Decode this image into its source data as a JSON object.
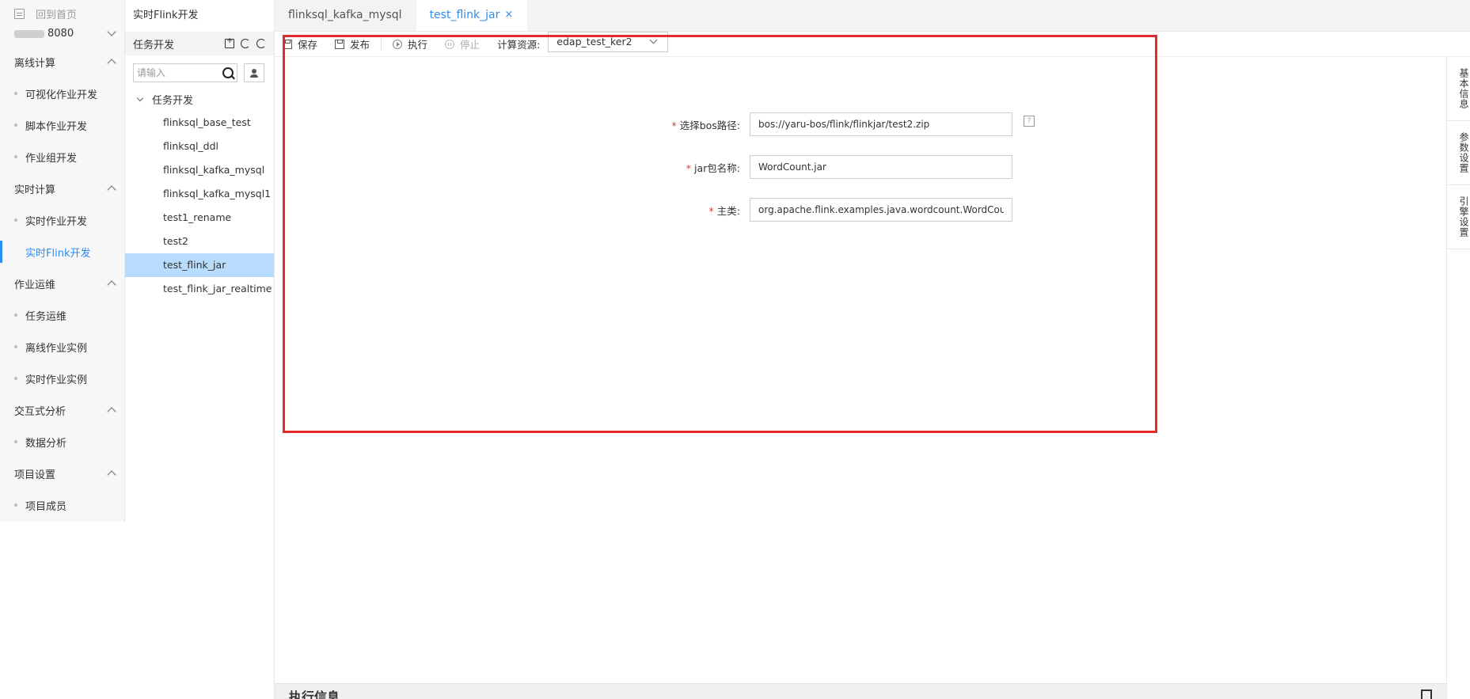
{
  "nav": {
    "home_label": "回到首页",
    "project_label": "8080",
    "groups": [
      {
        "title": "离线计算",
        "items": [
          "可视化作业开发",
          "脚本作业开发",
          "作业组开发"
        ]
      },
      {
        "title": "实时计算",
        "items": [
          "实时作业开发",
          "实时Flink开发"
        ]
      },
      {
        "title": "作业运维",
        "items": [
          "任务运维",
          "离线作业实例",
          "实时作业实例"
        ]
      },
      {
        "title": "交互式分析",
        "items": [
          "数据分析"
        ]
      },
      {
        "title": "项目设置",
        "items": [
          "项目成员"
        ]
      }
    ],
    "active_item": "实时Flink开发"
  },
  "tree": {
    "title": "实时Flink开发",
    "section_title": "任务开发",
    "search_placeholder": "请输入",
    "folder": "任务开发",
    "items": [
      "flinksql_base_test",
      "flinksql_ddl",
      "flinksql_kafka_mysql",
      "flinksql_kafka_mysql1",
      "test1_rename",
      "test2",
      "test_flink_jar",
      "test_flink_jar_realtime"
    ],
    "selected": "test_flink_jar"
  },
  "tabs": [
    {
      "label": "flinksql_kafka_mysql",
      "active": false
    },
    {
      "label": "test_flink_jar",
      "active": true,
      "close": "×"
    }
  ],
  "toolbar": {
    "save": "保存",
    "publish": "发布",
    "run": "执行",
    "stop": "停止",
    "resource_label": "计算资源:",
    "resource_value": "edap_test_ker2"
  },
  "form": {
    "bos_path_label": "选择bos路径:",
    "bos_path_value": "bos://yaru-bos/flink/flinkjar/test2.zip",
    "jar_name_label": "jar包名称:",
    "jar_name_value": "WordCount.jar",
    "main_class_label": "主类:",
    "main_class_value": "org.apache.flink.examples.java.wordcount.WordCount",
    "help": "?",
    "required_mark": "*"
  },
  "side_tabs": [
    "基本信息",
    "参数设置",
    "引擎设置"
  ],
  "exec_panel": {
    "title": "执行信息"
  },
  "colors": {
    "accent": "#2d8cf0",
    "highlight": "#e32a2a",
    "selected_bg": "#b8dcfb"
  }
}
